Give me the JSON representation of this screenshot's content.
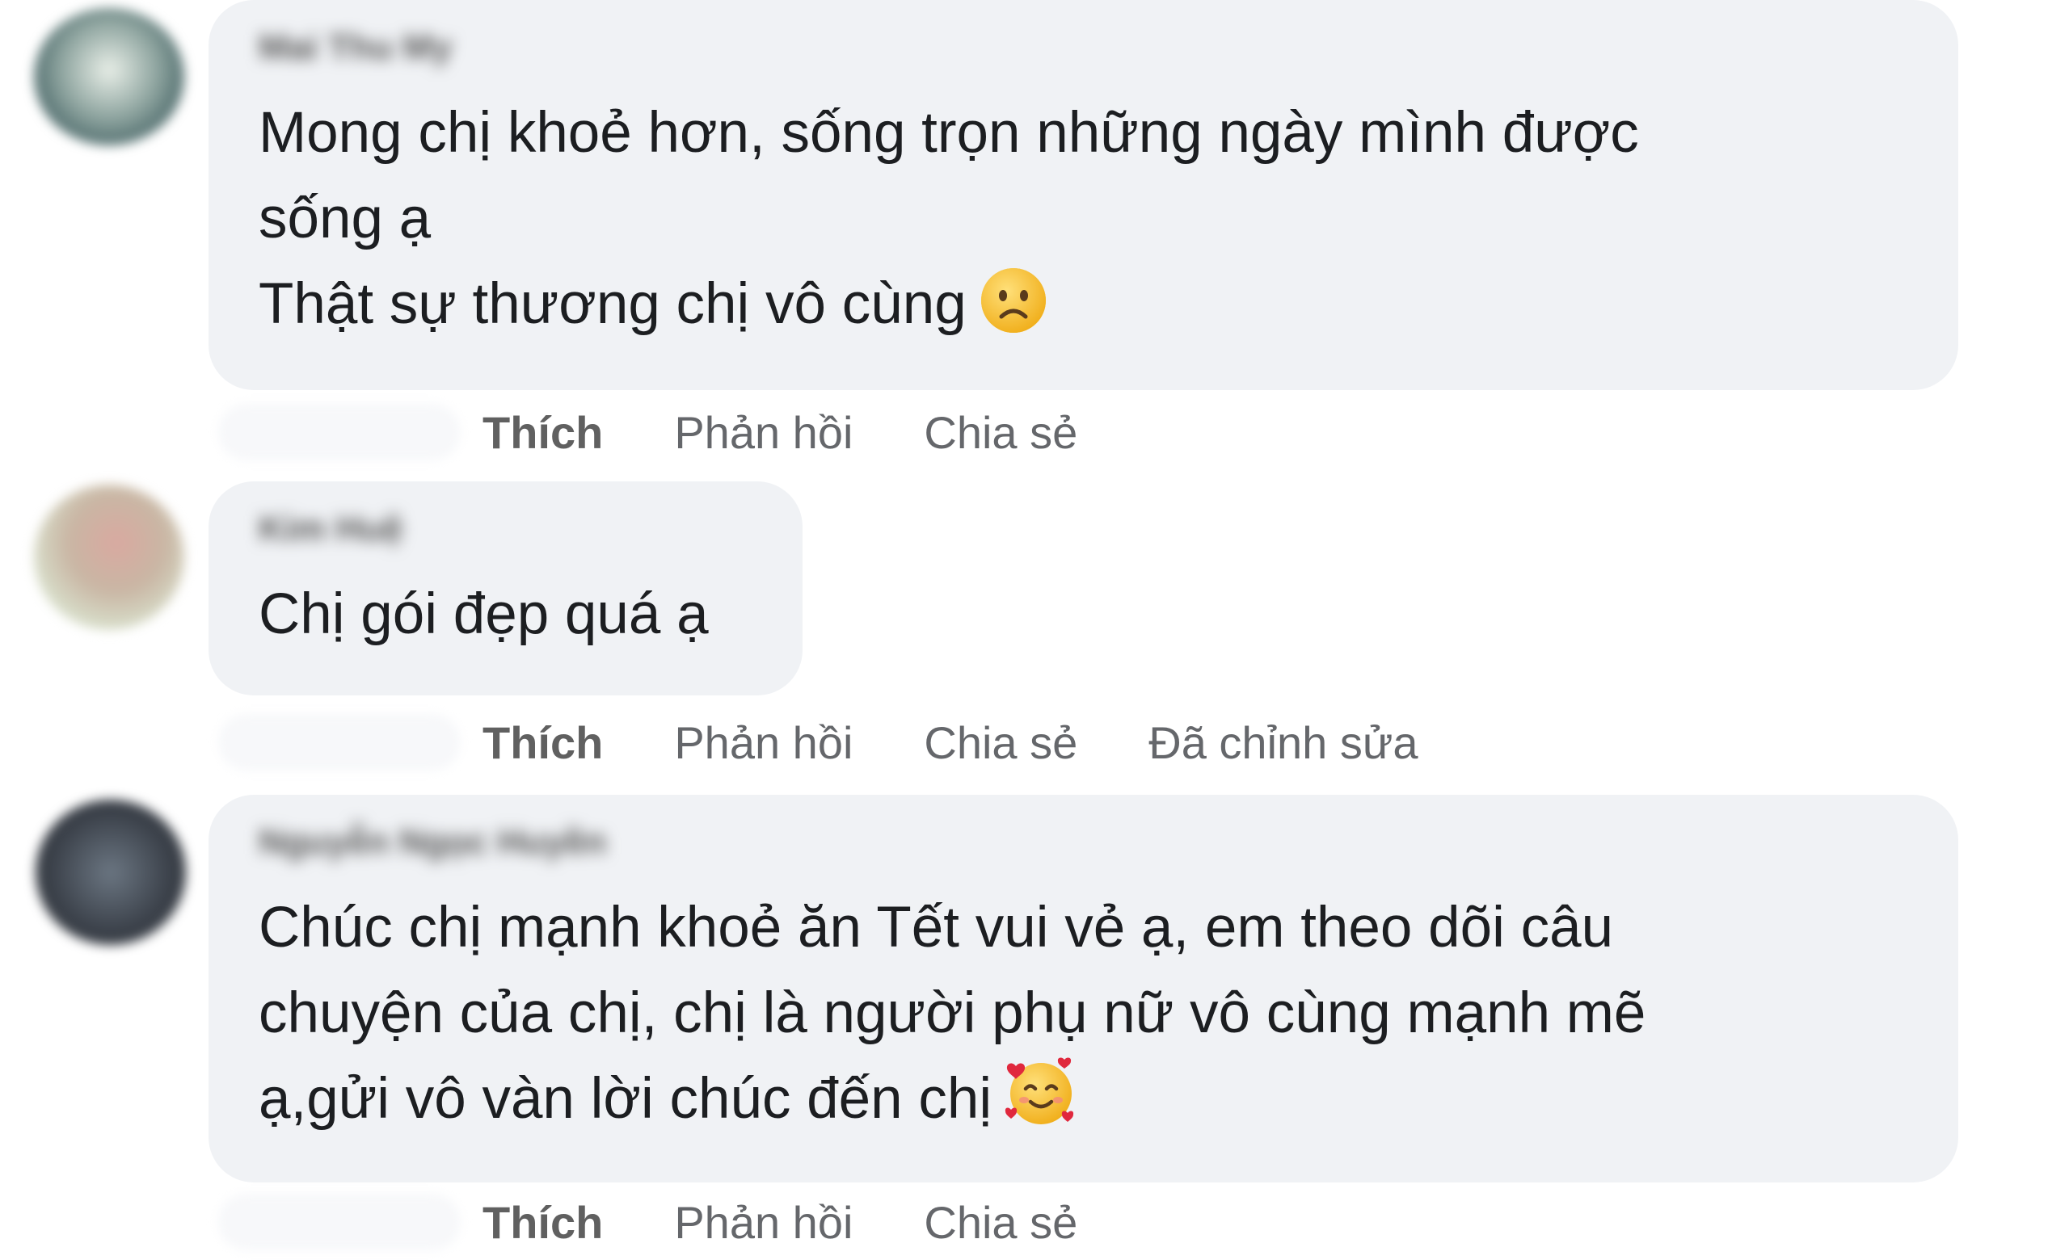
{
  "comments": [
    {
      "author": "Mai Thu My",
      "lines": [
        "Mong chị khoẻ hơn, sống trọn những ngày mình được",
        "sống ạ",
        "Thật sự thương chị vô cùng"
      ],
      "emoji": "sad-face-icon",
      "actions": {
        "like": "Thích",
        "reply": "Phản hồi",
        "share": "Chia sẻ"
      },
      "avatar_color": "#6f8a86"
    },
    {
      "author": "Kim Huệ",
      "lines": [
        "Chị gói đẹp quá ạ"
      ],
      "actions": {
        "like": "Thích",
        "reply": "Phản hồi",
        "share": "Chia sẻ",
        "edited": "Đã chỉnh sửa"
      },
      "avatar_color": "#b8a89c"
    },
    {
      "author": "Nguyễn Ngọc Huyền",
      "lines": [
        "Chúc chị mạnh khoẻ ăn Tết vui vẻ ạ, em theo dõi câu",
        "chuyện của chị, chị là người phụ nữ vô cùng mạnh mẽ",
        "ạ,gửi vô vàn lời chúc đến chị"
      ],
      "emoji": "smiling-face-with-hearts-icon",
      "actions": {
        "like": "Thích",
        "reply": "Phản hồi",
        "share": "Chia sẻ"
      },
      "avatar_color": "#3a3f47"
    }
  ]
}
